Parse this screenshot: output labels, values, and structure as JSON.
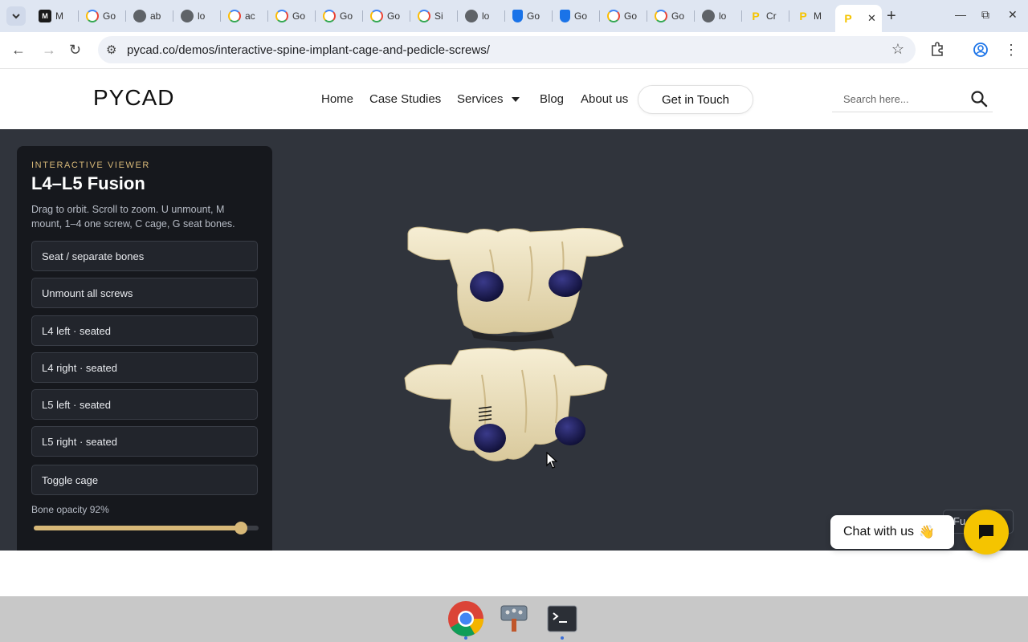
{
  "browser": {
    "tabs": [
      {
        "icon": "medium",
        "label": "M"
      },
      {
        "icon": "google",
        "label": "Go"
      },
      {
        "icon": "globe",
        "label": "ab"
      },
      {
        "icon": "globe",
        "label": "lo"
      },
      {
        "icon": "google",
        "label": "ac"
      },
      {
        "icon": "google",
        "label": "Go"
      },
      {
        "icon": "google",
        "label": "Go"
      },
      {
        "icon": "google",
        "label": "Go"
      },
      {
        "icon": "google",
        "label": "Si"
      },
      {
        "icon": "globe",
        "label": "lo"
      },
      {
        "icon": "shield",
        "label": "Go"
      },
      {
        "icon": "shield",
        "label": "Go"
      },
      {
        "icon": "google",
        "label": "Go"
      },
      {
        "icon": "google",
        "label": "Go"
      },
      {
        "icon": "globe",
        "label": "lo"
      },
      {
        "icon": "pycad",
        "label": "Cr"
      },
      {
        "icon": "pycad",
        "label": "M"
      },
      {
        "icon": "pycad",
        "label": ""
      }
    ],
    "url": "pycad.co/demos/interactive-spine-implant-cage-and-pedicle-screws/"
  },
  "site": {
    "logo": "PYCAD",
    "nav": {
      "home": "Home",
      "case_studies": "Case Studies",
      "services": "Services",
      "blog": "Blog",
      "about": "About us"
    },
    "cta": "Get in Touch",
    "search_placeholder": "Search here..."
  },
  "viewer": {
    "eyebrow": "INTERACTIVE VIEWER",
    "title": "L4–L5 Fusion",
    "description": "Drag to orbit. Scroll to zoom. U unmount, M mount, 1–4 one screw, C cage, G seat bones.",
    "buttons": {
      "seat": "Seat / separate bones",
      "unmount": "Unmount all screws",
      "l4_left": "L4 left · seated",
      "l4_right": "L4 right · seated",
      "l5_left": "L5 left · seated",
      "l5_right": "L5 right · seated",
      "cage": "Toggle cage"
    },
    "opacity_label": "Bone opacity 92%",
    "opacity_value": 0.92,
    "fullscreen_label": "Fu"
  },
  "chat": {
    "label": "Chat with us",
    "emoji": "👋"
  },
  "colors": {
    "accent": "#d7b878",
    "brand": "#f5c400",
    "viewer_bg": "#30343c",
    "panel_bg": "#16181d",
    "bone": "#efe4c2",
    "screw": "#1a1a52"
  },
  "taskbar": {
    "apps": [
      "chrome-icon",
      "pinta-icon",
      "terminal-icon"
    ]
  }
}
